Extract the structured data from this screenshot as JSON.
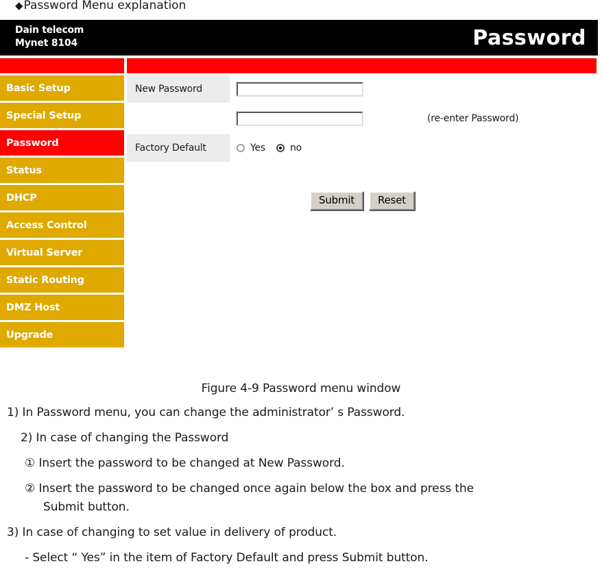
{
  "document": {
    "heading_marker": "◆",
    "heading": "Password Menu explanation",
    "caption": "Figure 4-9 Password menu window",
    "paragraphs": {
      "p1": "1) In Password menu, you can change the administrator’ s Password.",
      "p2": "2) In case of changing the Password",
      "p2a": "①  Insert the password to be changed at New Password.",
      "p2b": "②  Insert the password to be changed once again below the box and press the",
      "p2b_cont": "Submit button.",
      "p3": "3) In case of changing to set value in delivery of product.",
      "p3a": "- Select “ Yes” in the item of Factory Default and press Submit button."
    }
  },
  "router_ui": {
    "brand_line1": "Dain telecom",
    "brand_line2": "Mynet 8104",
    "page_title": "Password",
    "colors": {
      "titlebar": "#000000",
      "accent_red": "#ff0000",
      "nav_gold": "#dfa900",
      "label_gray": "#ececec",
      "button_face": "#d4d0c8"
    },
    "sidebar": {
      "items": [
        {
          "label": "Basic Setup",
          "active": false
        },
        {
          "label": "Special Setup",
          "active": false
        },
        {
          "label": "Password",
          "active": true
        },
        {
          "label": "Status",
          "active": false
        },
        {
          "label": "DHCP",
          "active": false
        },
        {
          "label": "Access Control",
          "active": false
        },
        {
          "label": "Virtual Server",
          "active": false
        },
        {
          "label": "Static Routing",
          "active": false
        },
        {
          "label": "DMZ Host",
          "active": false
        },
        {
          "label": "Upgrade",
          "active": false
        }
      ]
    },
    "form": {
      "new_password_label": "New Password",
      "new_password_value": "",
      "reenter_value": "",
      "reenter_hint": "(re-enter Password)",
      "factory_default_label": "Factory Default",
      "radio_yes_label": "Yes",
      "radio_no_label": "no",
      "radio_selected": "no"
    },
    "buttons": {
      "submit": "Submit",
      "reset": "Reset"
    }
  }
}
